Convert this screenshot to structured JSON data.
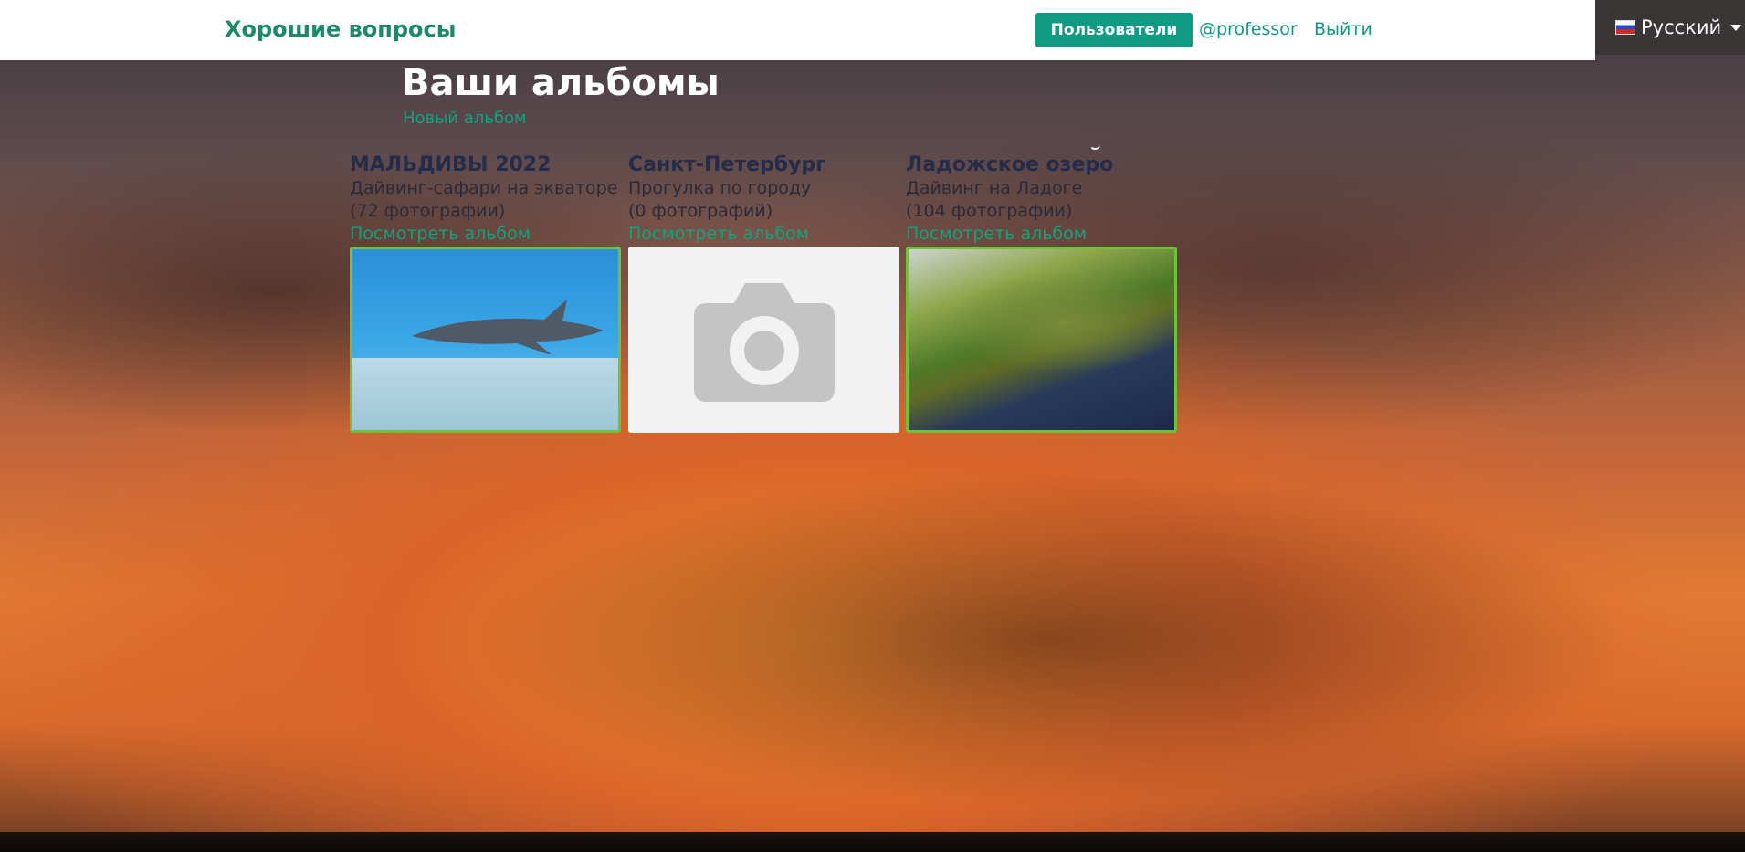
{
  "navbar": {
    "brand": "Хорошие вопросы",
    "users_button": "Пользователи",
    "username": "@professor",
    "logout": "Выйти"
  },
  "language": {
    "selected": "Русский",
    "flag_icon": "russia-flag-icon"
  },
  "page": {
    "title": "Ваши альбомы",
    "new_album_link": "Новый альбом"
  },
  "albums": [
    {
      "title": "МАЛЬДИВЫ 2022",
      "description": "Дайвинг-сафари на экваторе",
      "count": "(72 фотографии)",
      "link": "Посмотреть альбом",
      "thumbnail": "underwater-shark-photo"
    },
    {
      "title": "Санкт-Петербург",
      "description": "Прогулка по городу",
      "count": "(0 фотографий)",
      "link": "Посмотреть альбом",
      "thumbnail": "camera-placeholder-icon"
    },
    {
      "title": "Ладожское озеро",
      "description": "Дайвинг на Ладоге",
      "count": "(104 фотографии)",
      "link": "Посмотреть альбом",
      "thumbnail": "aerial-forest-lake-photo"
    }
  ],
  "colors": {
    "accent": "#0f9a83",
    "link": "#12a27e",
    "thumb_border": "#6ec23a",
    "lang_bg": "#3a3636"
  }
}
